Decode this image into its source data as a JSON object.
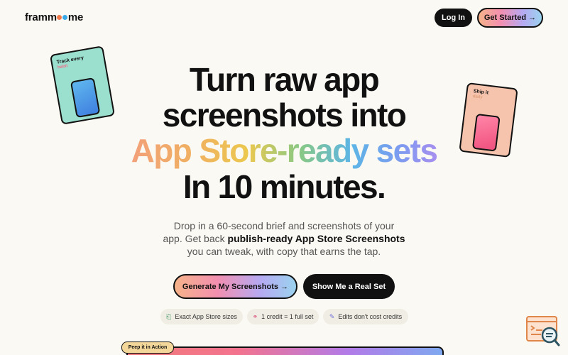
{
  "header": {
    "logo_parts": [
      "framm",
      "me"
    ],
    "login_label": "Log In",
    "get_started_label": "Get Started →"
  },
  "hero": {
    "line1": "Turn raw app",
    "line2": "screenshots into",
    "line3_gradient": "App Store-ready sets",
    "line4": "In 10 minutes."
  },
  "subtitle": {
    "line1": "Drop in a 60-second brief and screenshots of your",
    "line2_pre": "app. Get back ",
    "line2_bold": "publish-ready App Store Screenshots",
    "line3": "you can tweak, with copy that earns the tap."
  },
  "cta": {
    "generate_label": "Generate My Screenshots →",
    "real_set_label": "Show Me a Real Set"
  },
  "chips": [
    {
      "icon": "crop-icon",
      "glyph": "⎗",
      "label": "Exact App Store sizes"
    },
    {
      "icon": "link-icon",
      "glyph": "⚭",
      "label": "1 credit = 1 full set"
    },
    {
      "icon": "pencil-icon",
      "glyph": "✎",
      "label": "Edits don't cost credits"
    }
  ],
  "floating_cards": {
    "left": {
      "title": "Track every",
      "subtitle": "habit"
    },
    "right": {
      "title": "Ship it",
      "subtitle": "daily"
    }
  },
  "preview": {
    "badge_label": "Peep it in Action"
  },
  "colors": {
    "background": "#fbf9f3",
    "dark": "#111111",
    "left_card": "#9be0cf",
    "right_card": "#f6c3ad"
  }
}
